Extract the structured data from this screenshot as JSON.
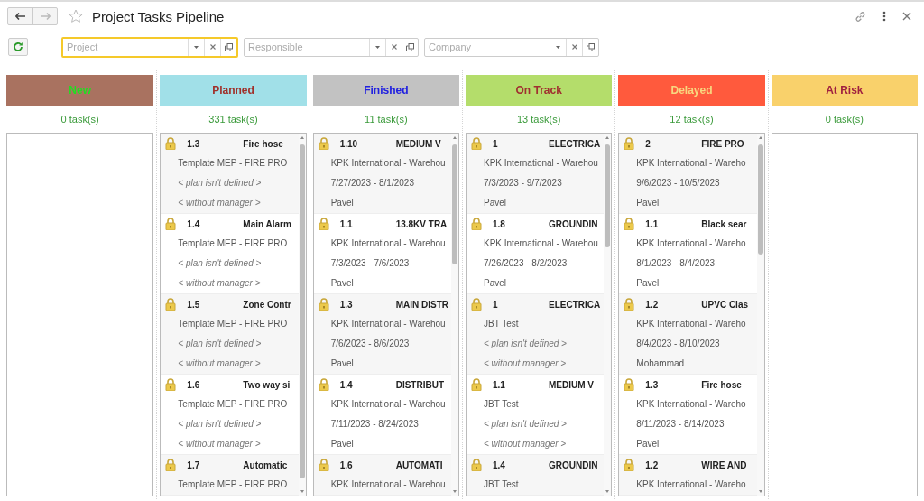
{
  "window": {
    "title": "Project Tasks Pipeline"
  },
  "filters": [
    {
      "placeholder": "Project",
      "focused": true
    },
    {
      "placeholder": "Responsible",
      "focused": false
    },
    {
      "placeholder": "Company",
      "focused": false
    }
  ],
  "columns": [
    {
      "title": {
        "text": "New",
        "color": "#22dd22"
      },
      "color": "#a97260",
      "count": "0 task(s)"
    },
    {
      "title": {
        "text": "Planned",
        "color": "#a0302a"
      },
      "color": "#a1e0e8",
      "count": "331 task(s)",
      "tasks": [
        {
          "number": "1.3",
          "name": "Fire hose",
          "lines": [
            {
              "kind": "text",
              "text": "Template MEP - FIRE PRO"
            },
            {
              "kind": "empty",
              "text": "< plan isn't defined >"
            },
            {
              "kind": "empty",
              "text": "< without manager >"
            }
          ]
        },
        {
          "number": "1.4",
          "name": "Main Alarm",
          "lines": [
            {
              "kind": "text",
              "text": "Template MEP - FIRE PRO"
            },
            {
              "kind": "empty",
              "text": "< plan isn't defined >"
            },
            {
              "kind": "empty",
              "text": "< without manager >"
            }
          ]
        },
        {
          "number": "1.5",
          "name": "Zone Contr",
          "lines": [
            {
              "kind": "text",
              "text": "Template MEP - FIRE PRO"
            },
            {
              "kind": "empty",
              "text": "< plan isn't defined >"
            },
            {
              "kind": "empty",
              "text": "< without manager >"
            }
          ]
        },
        {
          "number": "1.6",
          "name": "Two way si",
          "lines": [
            {
              "kind": "text",
              "text": "Template MEP - FIRE PRO"
            },
            {
              "kind": "empty",
              "text": "< plan isn't defined >"
            },
            {
              "kind": "empty",
              "text": "< without manager >"
            }
          ]
        },
        {
          "number": "1.7",
          "name": "Automatic",
          "lines": [
            {
              "kind": "text",
              "text": "Template MEP - FIRE PRO"
            }
          ]
        }
      ]
    },
    {
      "title": {
        "text": "Finished",
        "color": "#2020e0"
      },
      "color": "#c2c2c2",
      "count": "11 task(s)",
      "tasks": [
        {
          "number": "1.10",
          "name": "MEDIUM V",
          "lines": [
            {
              "kind": "text",
              "text": "KPK International - Warehou"
            },
            {
              "kind": "text",
              "text": "7/27/2023 - 8/1/2023"
            },
            {
              "kind": "text",
              "text": "Pavel"
            }
          ]
        },
        {
          "number": "1.1",
          "name": "13.8KV TRA",
          "lines": [
            {
              "kind": "text",
              "text": "KPK International - Warehou"
            },
            {
              "kind": "text",
              "text": "7/3/2023 - 7/6/2023"
            },
            {
              "kind": "text",
              "text": "Pavel"
            }
          ]
        },
        {
          "number": "1.3",
          "name": "MAIN DISTR",
          "lines": [
            {
              "kind": "text",
              "text": "KPK International - Warehou"
            },
            {
              "kind": "text",
              "text": "7/6/2023 - 8/6/2023"
            },
            {
              "kind": "text",
              "text": "Pavel"
            }
          ]
        },
        {
          "number": "1.4",
          "name": "DISTRIBUT",
          "lines": [
            {
              "kind": "text",
              "text": "KPK International - Warehou"
            },
            {
              "kind": "text",
              "text": "7/11/2023 - 8/24/2023"
            },
            {
              "kind": "text",
              "text": "Pavel"
            }
          ]
        },
        {
          "number": "1.6",
          "name": "AUTOMATI",
          "lines": [
            {
              "kind": "text",
              "text": "KPK International - Warehou"
            }
          ]
        }
      ]
    },
    {
      "title": {
        "text": "On Track",
        "color": "#a03030"
      },
      "color": "#b4dd6b",
      "count": "13 task(s)",
      "tasks": [
        {
          "number": "1",
          "name": "ELECTRICA",
          "lines": [
            {
              "kind": "text",
              "text": "KPK International - Warehou"
            },
            {
              "kind": "text",
              "text": "7/3/2023 - 9/7/2023"
            },
            {
              "kind": "text",
              "text": "Pavel"
            }
          ]
        },
        {
          "number": "1.8",
          "name": "GROUNDIN",
          "lines": [
            {
              "kind": "text",
              "text": "KPK International - Warehou"
            },
            {
              "kind": "text",
              "text": "7/26/2023 - 8/2/2023"
            },
            {
              "kind": "text",
              "text": "Pavel"
            }
          ]
        },
        {
          "number": "1",
          "name": "ELECTRICA",
          "lines": [
            {
              "kind": "text",
              "text": "JBT Test"
            },
            {
              "kind": "empty",
              "text": "< plan isn't defined >"
            },
            {
              "kind": "empty",
              "text": "< without manager >"
            }
          ]
        },
        {
          "number": "1.1",
          "name": "MEDIUM V",
          "lines": [
            {
              "kind": "text",
              "text": "JBT Test"
            },
            {
              "kind": "empty",
              "text": "< plan isn't defined >"
            },
            {
              "kind": "empty",
              "text": "< without manager >"
            }
          ]
        },
        {
          "number": "1.4",
          "name": "GROUNDIN",
          "lines": [
            {
              "kind": "text",
              "text": "JBT Test"
            }
          ]
        }
      ]
    },
    {
      "title": {
        "text": "Delayed",
        "color": "#f8d880"
      },
      "color": "#ff5a3d",
      "count": "12 task(s)",
      "tasks": [
        {
          "number": "2",
          "name": "FIRE PRO",
          "lines": [
            {
              "kind": "text",
              "text": "KPK International - Wareho"
            },
            {
              "kind": "text",
              "text": "9/6/2023 - 10/5/2023"
            },
            {
              "kind": "text",
              "text": "Pavel"
            }
          ]
        },
        {
          "number": "1.1",
          "name": "Black sear",
          "lines": [
            {
              "kind": "text",
              "text": "KPK International - Wareho"
            },
            {
              "kind": "text",
              "text": "8/1/2023 - 8/4/2023"
            },
            {
              "kind": "text",
              "text": "Pavel"
            }
          ]
        },
        {
          "number": "1.2",
          "name": "UPVC Clas",
          "lines": [
            {
              "kind": "text",
              "text": "KPK International - Wareho"
            },
            {
              "kind": "text",
              "text": "8/4/2023 - 8/10/2023"
            },
            {
              "kind": "text",
              "text": "Mohammad"
            }
          ]
        },
        {
          "number": "1.3",
          "name": "Fire hose",
          "lines": [
            {
              "kind": "text",
              "text": "KPK International - Wareho"
            },
            {
              "kind": "text",
              "text": "8/11/2023 - 8/14/2023"
            },
            {
              "kind": "text",
              "text": "Pavel"
            }
          ]
        },
        {
          "number": "1.2",
          "name": "WIRE AND",
          "lines": [
            {
              "kind": "text",
              "text": "KPK International - Wareho"
            }
          ]
        }
      ]
    },
    {
      "title": {
        "text": "At Risk",
        "color": "#a02040"
      },
      "color": "#f9d16b",
      "count": "0 task(s)"
    }
  ]
}
